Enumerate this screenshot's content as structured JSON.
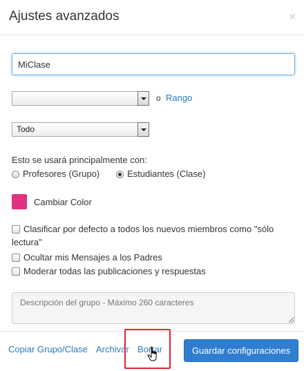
{
  "dialog": {
    "title": "Ajustes avanzados",
    "close_glyph": "×"
  },
  "form": {
    "name_value": "MiClase",
    "select1_value": "",
    "or_text": "o",
    "range_link": "Rango",
    "select2_value": "Todo",
    "usage_label": "Esto se usará principalmente con:",
    "radio_teachers": "Profesores (Grupo)",
    "radio_students": "Estudiantes (Clase)",
    "selected_radio": "students",
    "color_label": "Cambiar Color",
    "color": "#e2317e",
    "check_readonly": "Clasificar por defecto a todos los nuevos miembros como \"sólo lectura\"",
    "check_hide_messages": "Ocultar mis Mensajes a los Padres",
    "check_moderate": "Moderar todas las publicaciones y respuestas",
    "description_placeholder": "Descripción del grupo - Máximo 260 caracteres"
  },
  "footer": {
    "copy_link": "Copiar Grupo/Clase",
    "archive_link": "Archivar",
    "delete_link": "Borrar",
    "save_button": "Guardar configuraciones"
  },
  "icons": {
    "close": "close-icon",
    "cursor": "hand-pointer-icon"
  },
  "colors": {
    "accent": "#2f7ed0",
    "link": "#2a7ac0",
    "highlight": "#e0242b"
  }
}
